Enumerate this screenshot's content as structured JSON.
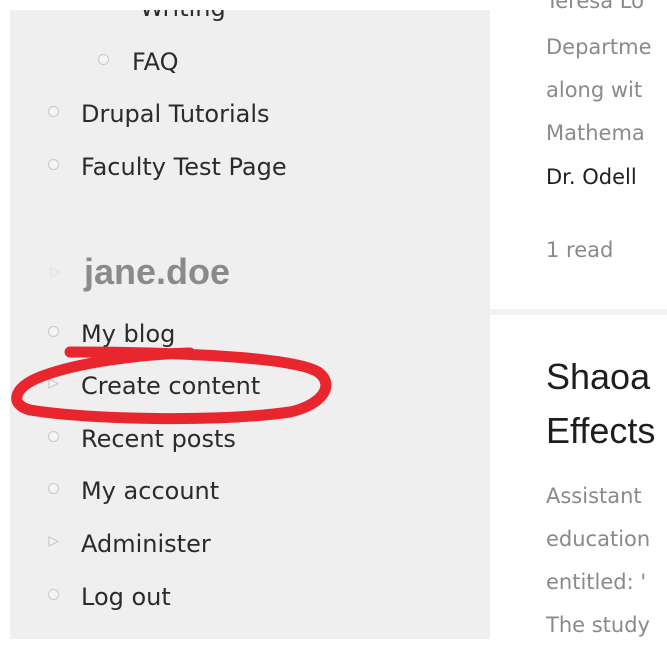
{
  "sidebar": {
    "cut_top_text": "Writing",
    "faq": "FAQ",
    "items_top": [
      {
        "label": "Drupal Tutorials"
      },
      {
        "label": "Faculty Test Page"
      }
    ],
    "user_section_title": "jane.doe",
    "user_menu": [
      {
        "label": "My blog",
        "bullet": "circle"
      },
      {
        "label": "Create content",
        "bullet": "triangle"
      },
      {
        "label": "Recent posts",
        "bullet": "circle"
      },
      {
        "label": "My account",
        "bullet": "circle"
      },
      {
        "label": "Administer",
        "bullet": "triangle"
      },
      {
        "label": "Log out",
        "bullet": "circle"
      }
    ]
  },
  "annotation": {
    "color": "#e8141c",
    "target": "Create content"
  },
  "main": {
    "article1": {
      "cut_top": "Teresa Lo",
      "lines": [
        "Departme",
        "along wit",
        "Mathema"
      ],
      "author": "Dr. Odell",
      "reads": "1 read"
    },
    "article2": {
      "title_lines": [
        "Shaoa",
        "Effects"
      ],
      "lines": [
        "Assistant",
        "education",
        "entitled: '",
        "The study"
      ]
    }
  },
  "colors": {
    "sidebar_bg": "#efefef",
    "link_text": "#2b2b2b",
    "muted_text": "#8a8a8a"
  }
}
